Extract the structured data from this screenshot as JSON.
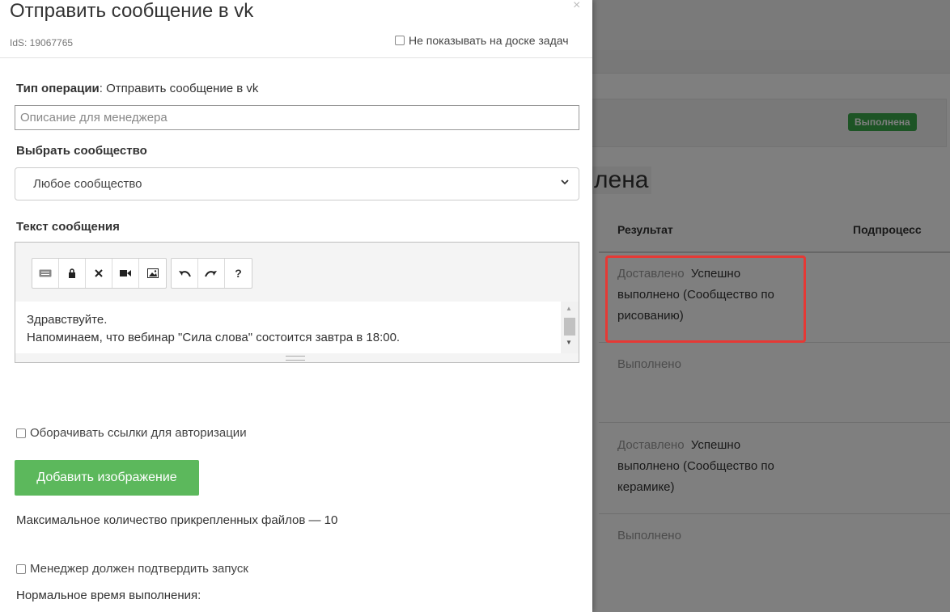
{
  "modal": {
    "title": "Отправить сообщение в vk",
    "close": "×",
    "ids": "IdS: 19067765",
    "hide_on_board": "Не показывать на доске задач",
    "operation_type_label": "Тип операции",
    "operation_type_value": ": Отправить сообщение в vk",
    "description_placeholder": "Описание для менеджера",
    "community_label": "Выбрать сообщество",
    "community_selected": "Любое сообщество",
    "message_label": "Текст сообщения",
    "editor_toolbar_icons": [
      "keyboard-icon",
      "lock-icon",
      "clear-icon",
      "video-icon",
      "image-icon",
      "undo-icon",
      "redo-icon",
      "help-icon"
    ],
    "editor_text_line1": "Здравствуйте.",
    "editor_text_line2": "Напоминаем, что вебинар \"Сила слова\" состоится завтра в 18:00.",
    "wrap_links": "Оборачивать ссылки для авторизации",
    "add_image_button": "Добавить изображение",
    "max_files": "Максимальное количество прикрепленных файлов — 10",
    "manager_confirm": "Менеджер должен подтвердить запуск",
    "normal_time": "Нормальное время выполнения:"
  },
  "background": {
    "status_badge": "Выполнена",
    "title_fragment": "лена",
    "col_result": "Результат",
    "col_subprocess": "Подпроцесс",
    "rows": [
      {
        "muted": "Доставлено",
        "text": "Успешно выполнено (Сообщество по рисованию)"
      },
      {
        "muted": "Выполнено",
        "text": ""
      },
      {
        "muted": "Доставлено",
        "text": "Успешно выполнено (Сообщество по керамике)"
      },
      {
        "muted": "Выполнено",
        "text": ""
      }
    ],
    "colors": {
      "badge": "#3aa84b",
      "highlight": "#e53935",
      "button": "#5cb85c"
    }
  }
}
